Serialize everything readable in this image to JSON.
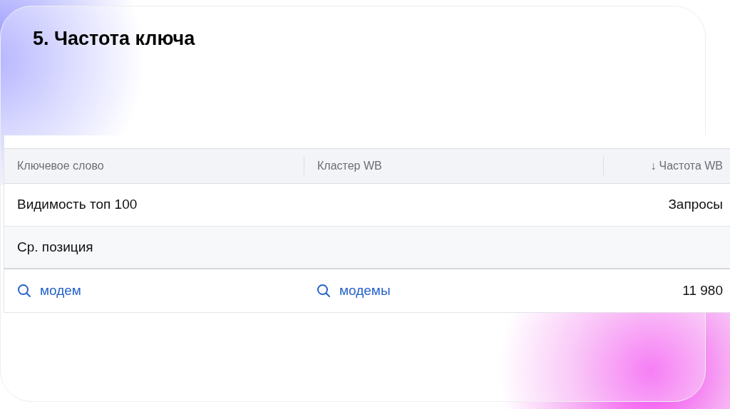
{
  "slide": {
    "title": "5. Частота ключа"
  },
  "table": {
    "columns": [
      {
        "label": "Ключевое слово"
      },
      {
        "label": "Кластер WB"
      },
      {
        "label": "Частота WB",
        "sort_arrow": "↓"
      }
    ],
    "summary_rows": [
      {
        "label": "Видимость топ 100",
        "value": "Запросы"
      },
      {
        "label": "Ср. позиция"
      }
    ],
    "rows": [
      {
        "keyword": "модем",
        "cluster": "модемы",
        "frequency": "11 980"
      }
    ]
  }
}
